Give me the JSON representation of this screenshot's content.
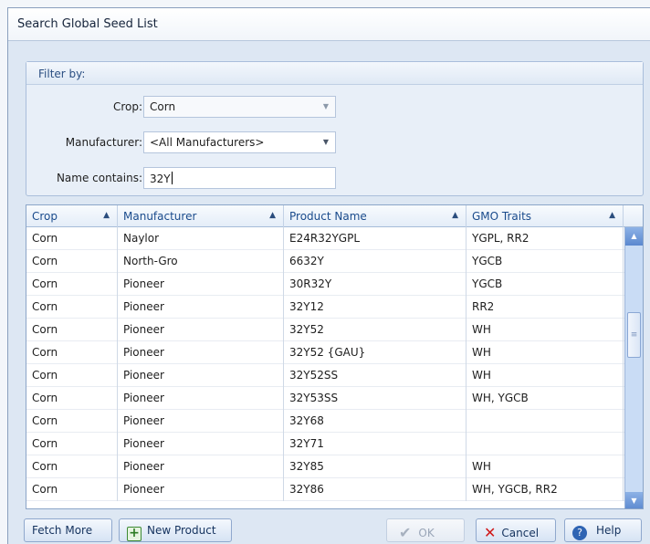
{
  "window": {
    "title": "Search Global Seed List"
  },
  "filter": {
    "header": "Filter by:",
    "crop": {
      "label": "Crop:",
      "value": "Corn"
    },
    "manufacturer": {
      "label": "Manufacturer:",
      "value": "<All Manufacturers>"
    },
    "name": {
      "label": "Name contains:",
      "value": "32Y"
    }
  },
  "grid": {
    "columns": [
      "Crop",
      "Manufacturer",
      "Product Name",
      "GMO Traits"
    ],
    "sort_indicator": "▲",
    "rows": [
      [
        "Corn",
        "Naylor",
        "E24R32YGPL",
        "YGPL, RR2"
      ],
      [
        "Corn",
        "North-Gro",
        "6632Y",
        "YGCB"
      ],
      [
        "Corn",
        "Pioneer",
        "30R32Y",
        "YGCB"
      ],
      [
        "Corn",
        "Pioneer",
        "32Y12",
        "RR2"
      ],
      [
        "Corn",
        "Pioneer",
        "32Y52",
        "WH"
      ],
      [
        "Corn",
        "Pioneer",
        "32Y52 {GAU}",
        "WH"
      ],
      [
        "Corn",
        "Pioneer",
        "32Y52SS",
        "WH"
      ],
      [
        "Corn",
        "Pioneer",
        "32Y53SS",
        "WH, YGCB"
      ],
      [
        "Corn",
        "Pioneer",
        "32Y68",
        ""
      ],
      [
        "Corn",
        "Pioneer",
        "32Y71",
        ""
      ],
      [
        "Corn",
        "Pioneer",
        "32Y85",
        "WH"
      ],
      [
        "Corn",
        "Pioneer",
        "32Y86",
        "WH, YGCB, RR2"
      ]
    ]
  },
  "buttons": {
    "fetch_more": "Fetch More",
    "new_product": "New Product",
    "ok": "OK",
    "cancel": "Cancel",
    "help": "Help"
  }
}
